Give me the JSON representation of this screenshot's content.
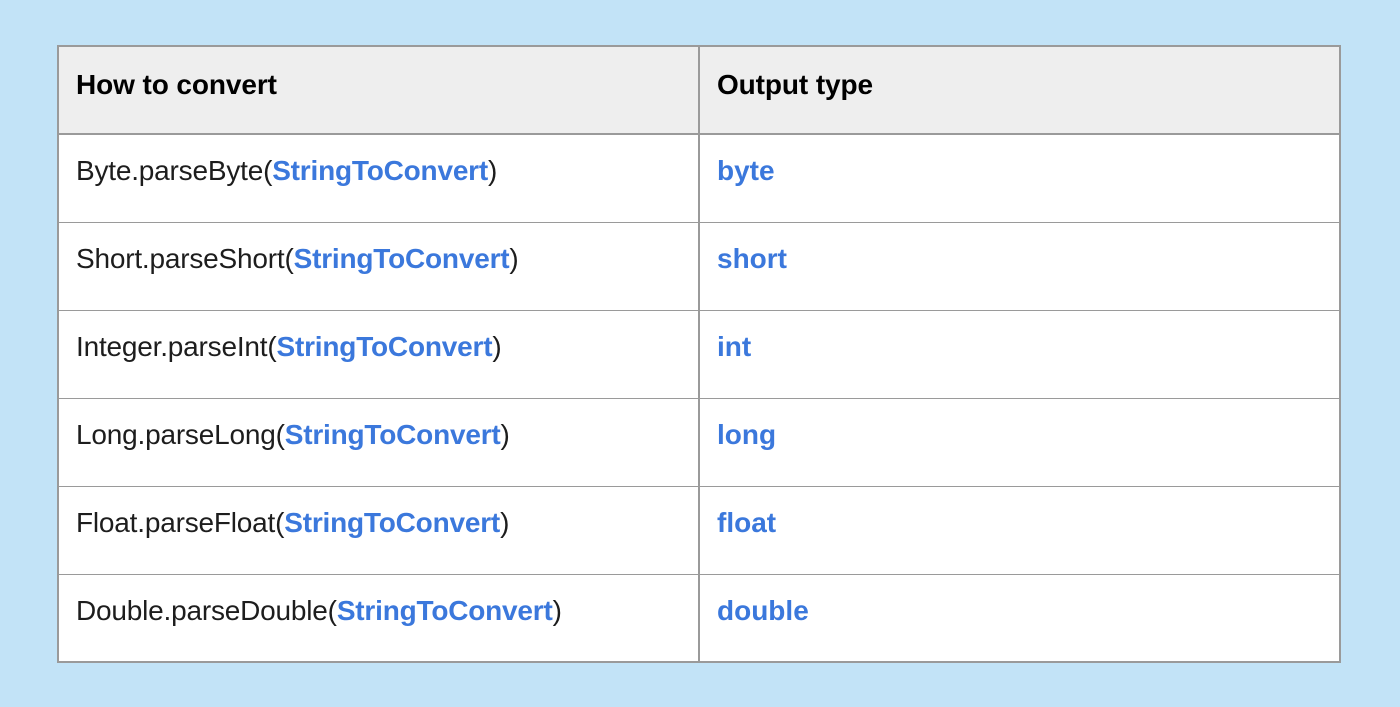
{
  "page": {
    "background_color": "#c2e3f7"
  },
  "table": {
    "name": "string-conversion-table",
    "border_color": "#9a9a9a",
    "header_background": "#eeeeee",
    "accent_color": "#3b78dc",
    "columns": [
      {
        "key": "how_to_convert",
        "label": "How to convert"
      },
      {
        "key": "output_type",
        "label": "Output type"
      }
    ],
    "rows": [
      {
        "method_prefix": "Byte.parseByte(",
        "argument": "StringToConvert",
        "method_suffix": ")",
        "output_type": "byte"
      },
      {
        "method_prefix": "Short.parseShort(",
        "argument": "StringToConvert",
        "method_suffix": ")",
        "output_type": "short"
      },
      {
        "method_prefix": "Integer.parseInt(",
        "argument": "StringToConvert",
        "method_suffix": ")",
        "output_type": "int"
      },
      {
        "method_prefix": "Long.parseLong(",
        "argument": "StringToConvert",
        "method_suffix": ")",
        "output_type": "long"
      },
      {
        "method_prefix": "Float.parseFloat(",
        "argument": "StringToConvert",
        "method_suffix": ")",
        "output_type": "float"
      },
      {
        "method_prefix": "Double.parseDouble(",
        "argument": "StringToConvert",
        "method_suffix": ")",
        "output_type": "double"
      }
    ]
  }
}
